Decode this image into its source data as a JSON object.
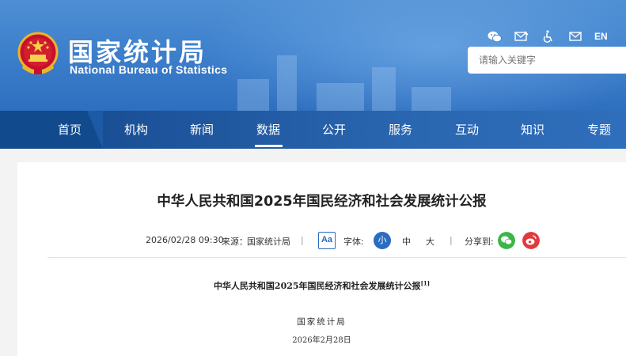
{
  "header": {
    "site_title_cn": "国家统计局",
    "site_title_en": "National Bureau of Statistics",
    "lang_toggle": "EN",
    "search_placeholder": "请输入关键字",
    "toolbar_icons": [
      "wechat-icon",
      "mail-edit-icon",
      "accessibility-icon",
      "mail-icon"
    ]
  },
  "nav": {
    "items": [
      "首页",
      "机构",
      "新闻",
      "数据",
      "公开",
      "服务",
      "互动",
      "知识",
      "专题"
    ],
    "active": "数据"
  },
  "article": {
    "title": "中华人民共和国2025年国民经济和社会发展统计公报",
    "datetime": "2026/02/28 09:30",
    "source_label": "来源：",
    "source": "国家统计局",
    "font_toggle": "Aa",
    "font_size_label": "字体:",
    "font_sizes": [
      "小",
      "中",
      "大"
    ],
    "share_label": "分享到:",
    "share_icons": [
      "wechat-share-icon",
      "weibo-share-icon"
    ],
    "body_title": "中华人民共和国2025年国民经济和社会发展统计公报",
    "body_title_note": "[1]",
    "body_org": "国家统计局",
    "body_date": "2026年2月28日"
  },
  "colors": {
    "banner_blue": "#3d80cc",
    "nav_blue": "#1d5aa6",
    "accent_blue": "#2a6cc0",
    "wechat_green": "#3bb54a",
    "weibo_red": "#e0393e"
  }
}
